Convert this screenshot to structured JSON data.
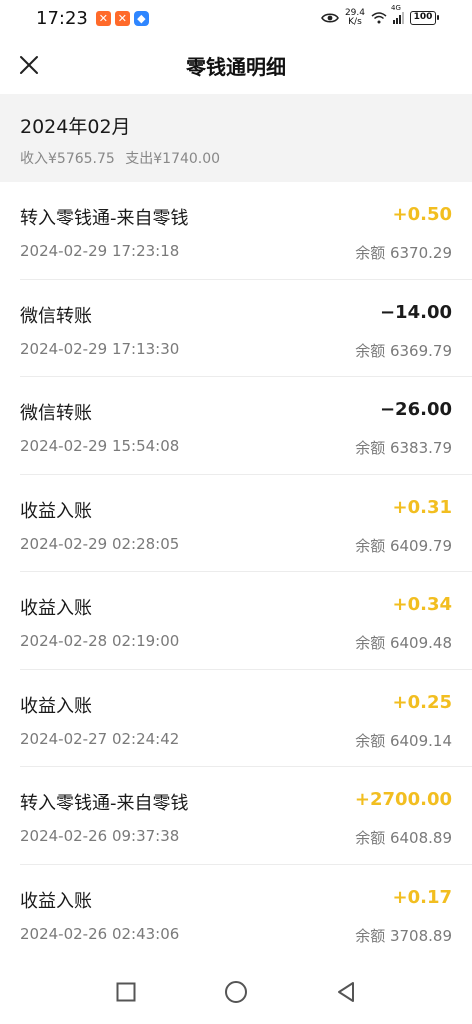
{
  "status_bar": {
    "time": "17:23",
    "net_speed_value": "29.4",
    "net_speed_unit": "K/s",
    "network_type": "4G",
    "battery": "100"
  },
  "header": {
    "title": "零钱通明细"
  },
  "month": {
    "title": "2024年02月",
    "income": "收入¥5765.75",
    "expense": "支出¥1740.00"
  },
  "transactions": [
    {
      "title": "转入零钱通-来自零钱",
      "amount": "+0.50",
      "type": "income",
      "time": "2024-02-29 17:23:18",
      "balance": "余额 6370.29"
    },
    {
      "title": "微信转账",
      "amount": "−14.00",
      "type": "expense",
      "time": "2024-02-29 17:13:30",
      "balance": "余额 6369.79"
    },
    {
      "title": "微信转账",
      "amount": "−26.00",
      "type": "expense",
      "time": "2024-02-29 15:54:08",
      "balance": "余额 6383.79"
    },
    {
      "title": "收益入账",
      "amount": "+0.31",
      "type": "income",
      "time": "2024-02-29 02:28:05",
      "balance": "余额 6409.79"
    },
    {
      "title": "收益入账",
      "amount": "+0.34",
      "type": "income",
      "time": "2024-02-28 02:19:00",
      "balance": "余额 6409.48"
    },
    {
      "title": "收益入账",
      "amount": "+0.25",
      "type": "income",
      "time": "2024-02-27 02:24:42",
      "balance": "余额 6409.14"
    },
    {
      "title": "转入零钱通-来自零钱",
      "amount": "+2700.00",
      "type": "income",
      "time": "2024-02-26 09:37:38",
      "balance": "余额 6408.89"
    },
    {
      "title": "收益入账",
      "amount": "+0.17",
      "type": "income",
      "time": "2024-02-26 02:43:06",
      "balance": "余额 3708.89"
    }
  ],
  "colors": {
    "income": "#f2be20",
    "expense": "#1a1a1a",
    "section_bg": "#f3f3f3"
  },
  "icons": {
    "close": "close-icon",
    "nav_recent": "square-icon",
    "nav_home": "circle-icon",
    "nav_back": "triangle-back-icon"
  }
}
